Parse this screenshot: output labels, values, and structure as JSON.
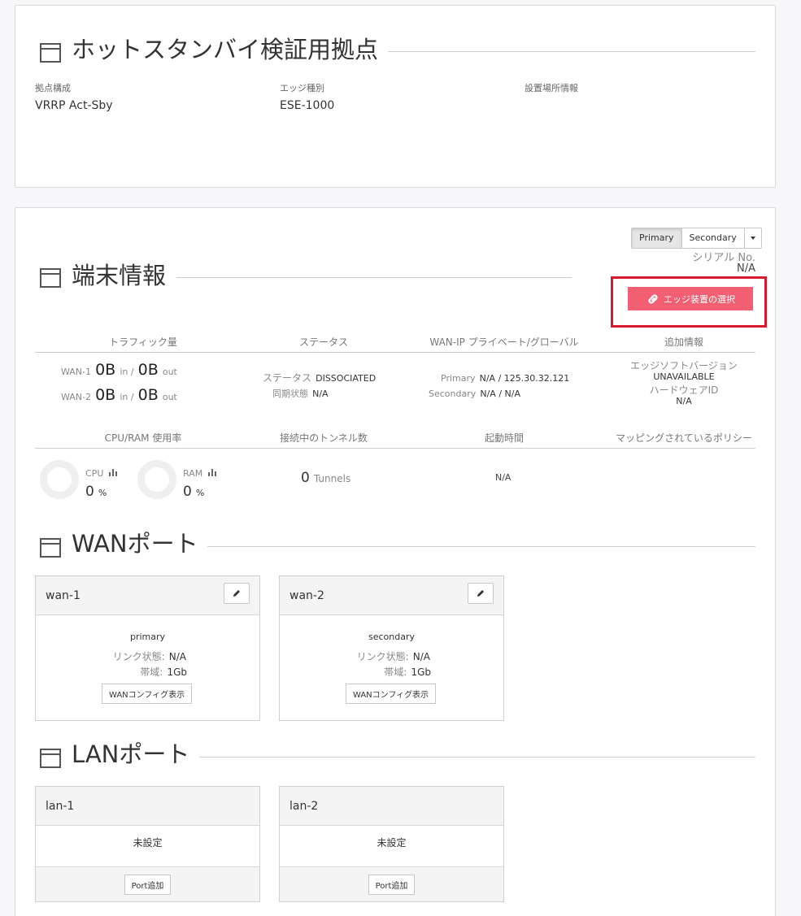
{
  "site": {
    "title": "ホットスタンバイ検証用拠点",
    "fields": [
      {
        "label": "拠点構成",
        "value": "VRRP Act-Sby"
      },
      {
        "label": "エッジ種別",
        "value": "ESE-1000"
      },
      {
        "label": "設置場所情報",
        "value": ""
      }
    ]
  },
  "device": {
    "title": "端末情報",
    "toggle": {
      "primary": "Primary",
      "secondary": "Secondary"
    },
    "serial_label": "シリアル No.",
    "serial_value": "N/A",
    "edge_select_button": "エッジ装置の選択",
    "headers": {
      "traffic": "トラフィック量",
      "status": "ステータス",
      "wan_ip": "WAN-IP プライベート/グローバル",
      "extra": "追加情報",
      "cpu_ram": "CPU/RAM 使用率",
      "tunnels": "接続中のトンネル数",
      "uptime": "起動時間",
      "policy": "マッピングされているポリシー"
    },
    "traffic": [
      {
        "wan": "WAN-1",
        "in_value": "0B",
        "in_label": "in /",
        "out_value": "0B",
        "out_label": "out"
      },
      {
        "wan": "WAN-2",
        "in_value": "0B",
        "in_label": "in /",
        "out_value": "0B",
        "out_label": "out"
      }
    ],
    "status": {
      "status_label": "ステータス",
      "status_value": "DISSOCIATED",
      "sync_label": "同期状態",
      "sync_value": "N/A"
    },
    "wan_ip": {
      "primary_label": "Primary",
      "primary_value": "N/A / 125.30.32.121",
      "secondary_label": "Secondary",
      "secondary_value": "N/A / N/A"
    },
    "extra": {
      "sw_label": "エッジソフトバージョン",
      "sw_value": "UNAVAILABLE",
      "hw_label": "ハードウェアID",
      "hw_value": "N/A"
    },
    "cpu": {
      "label": "CPU",
      "value": "0",
      "unit": "%"
    },
    "ram": {
      "label": "RAM",
      "value": "0",
      "unit": "%"
    },
    "tunnels": {
      "value": "0",
      "unit": "Tunnels"
    },
    "uptime": "N/A"
  },
  "wan_ports": {
    "title": "WANポート",
    "ports": [
      {
        "name": "wan-1",
        "role": "primary",
        "link_label": "リンク状態:",
        "link_value": "N/A",
        "bw_label": "帯域:",
        "bw_value": "1Gb",
        "config_button": "WANコンフィグ表示"
      },
      {
        "name": "wan-2",
        "role": "secondary",
        "link_label": "リンク状態:",
        "link_value": "N/A",
        "bw_label": "帯域:",
        "bw_value": "1Gb",
        "config_button": "WANコンフィグ表示"
      }
    ]
  },
  "lan_ports": {
    "title": "LANポート",
    "ports": [
      {
        "name": "lan-1",
        "status": "未設定",
        "add_button": "Port追加"
      },
      {
        "name": "lan-2",
        "status": "未設定",
        "add_button": "Port追加"
      }
    ]
  },
  "colors": {
    "accent": "#f25f72",
    "highlight_box": "#d9172d"
  },
  "icons": [
    "panel-icon",
    "link-icon",
    "pencil-icon",
    "bar-chart-icon",
    "caret-down-icon"
  ]
}
